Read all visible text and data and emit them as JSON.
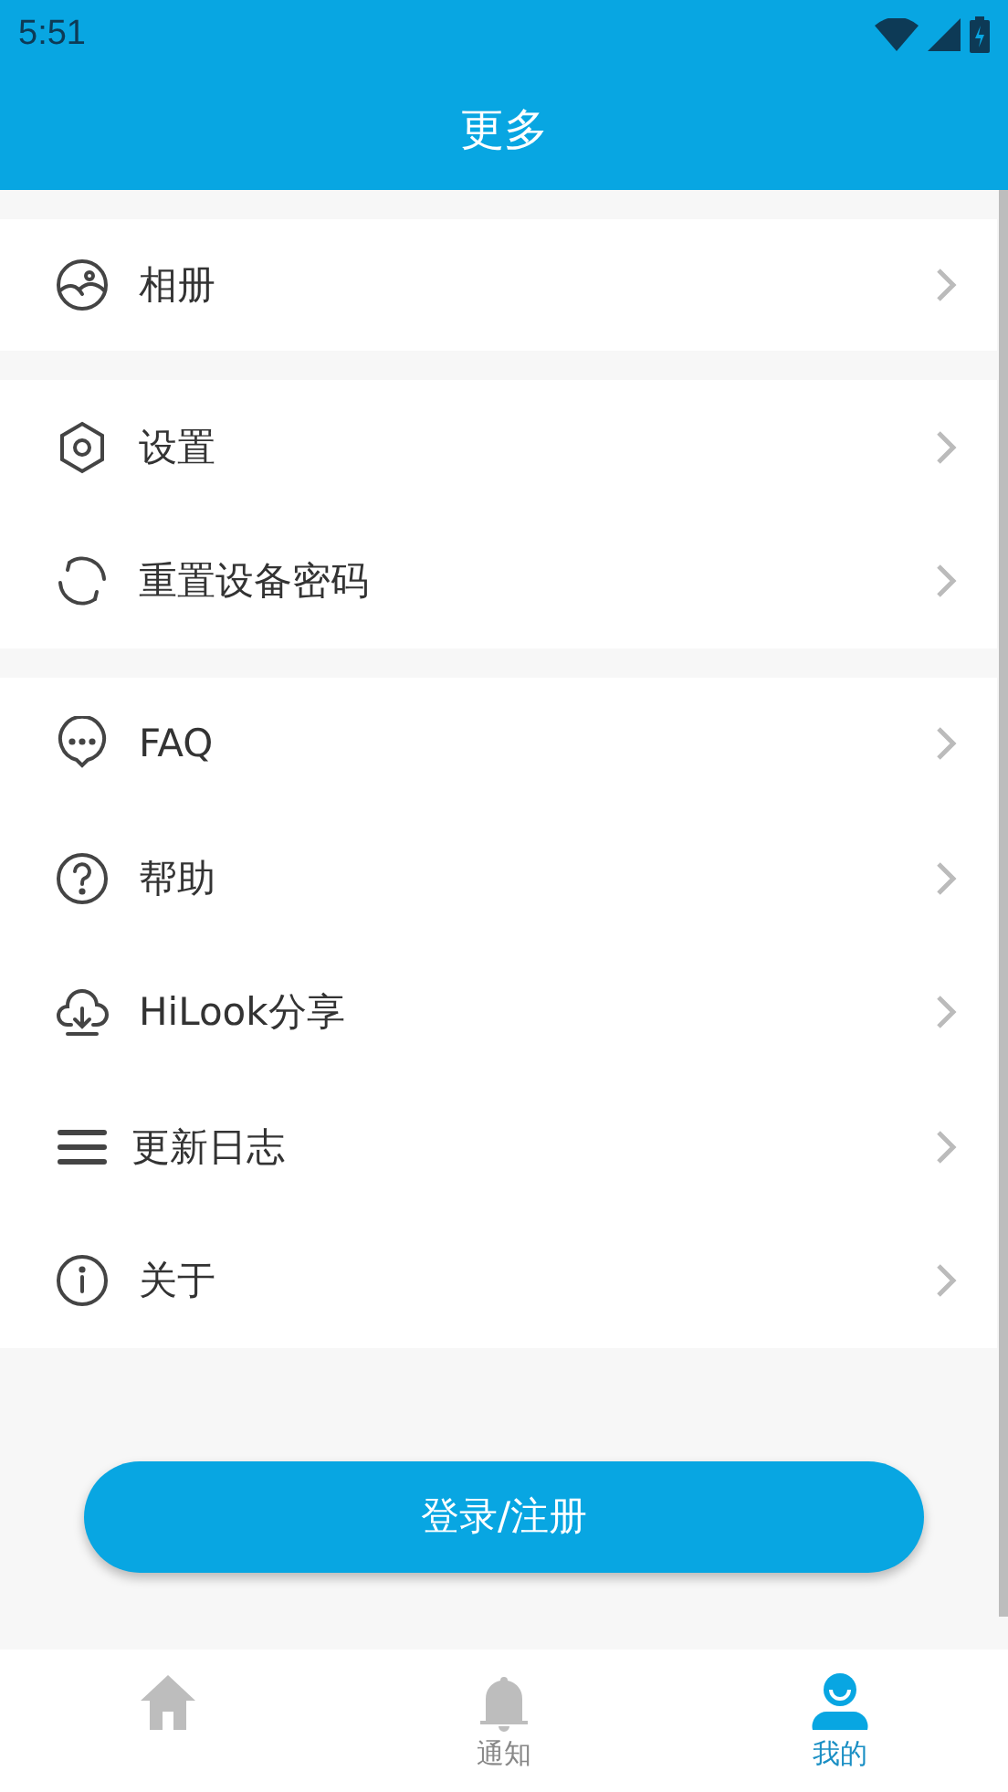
{
  "status_bar": {
    "time": "5:51"
  },
  "header": {
    "title": "更多"
  },
  "groups": [
    {
      "items": [
        {
          "kind": "album",
          "label": "相册"
        }
      ]
    },
    {
      "items": [
        {
          "kind": "settings",
          "label": "设置"
        },
        {
          "kind": "reset",
          "label": "重置设备密码"
        }
      ]
    },
    {
      "items": [
        {
          "kind": "faq",
          "label": "FAQ"
        },
        {
          "kind": "help",
          "label": "帮助"
        },
        {
          "kind": "share",
          "label": "HiLook分享"
        },
        {
          "kind": "log",
          "label": "更新日志"
        },
        {
          "kind": "about",
          "label": "关于"
        }
      ]
    }
  ],
  "login_button": {
    "label": "登录/注册"
  },
  "tab_bar": [
    {
      "kind": "home",
      "selected": false
    },
    {
      "kind": "notify",
      "label": "通知",
      "selected": false
    },
    {
      "kind": "me",
      "label": "我的",
      "selected": true
    }
  ]
}
